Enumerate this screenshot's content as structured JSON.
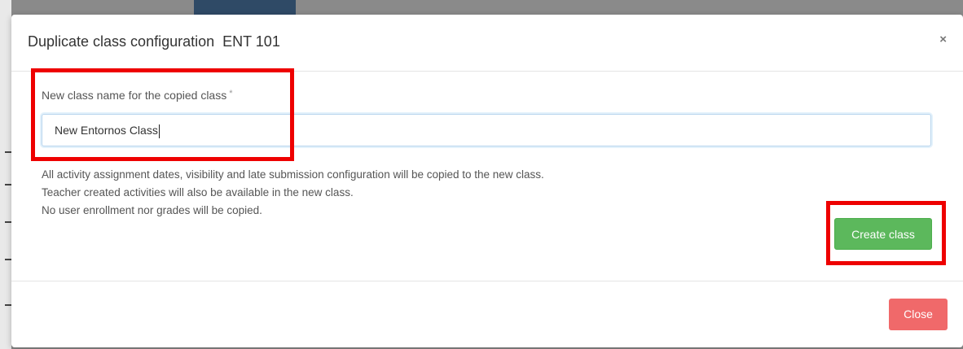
{
  "dialog": {
    "title": "Duplicate class configuration  ENT 101",
    "close_icon_glyph": "×"
  },
  "form": {
    "label": "New class name for the copied class",
    "required_mark": "*",
    "input_value": "New Entornos Class"
  },
  "info_lines": [
    "All activity assignment dates, visibility and late submission configuration will be copied to the new class.",
    "Teacher created activities will also be available in the new class.",
    "No user enrollment nor grades will be copied."
  ],
  "buttons": {
    "create_label": "Create class",
    "close_label": "Close"
  },
  "colors": {
    "create_button": "#5cb85c",
    "close_button": "#f0696a",
    "highlight": "#ee0000"
  }
}
